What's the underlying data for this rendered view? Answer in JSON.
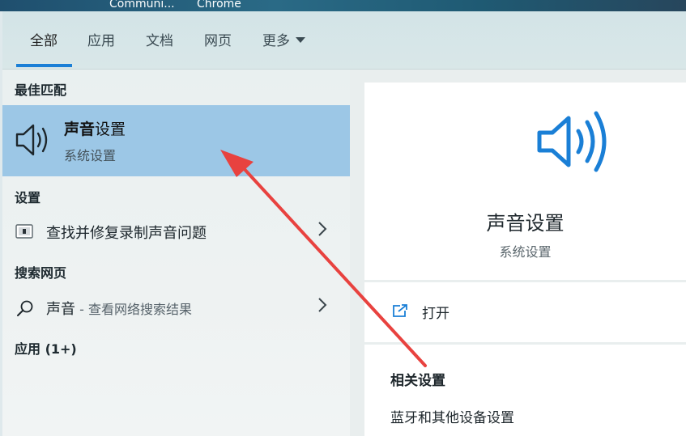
{
  "desktop": {
    "labels": [
      "Communi...",
      "Chrome"
    ]
  },
  "nav": {
    "tabs": [
      {
        "label": "全部",
        "active": true
      },
      {
        "label": "应用"
      },
      {
        "label": "文档"
      },
      {
        "label": "网页"
      },
      {
        "label": "更多"
      }
    ]
  },
  "left": {
    "best_match_heading": "最佳匹配",
    "best_match": {
      "title_bold": "声音",
      "title_rest": "设置",
      "subtitle": "系统设置",
      "icon": "speaker-icon"
    },
    "settings_heading": "设置",
    "settings_item": {
      "label": "查找并修复录制声音问题",
      "icon": "troubleshoot-icon"
    },
    "web_heading": "搜索网页",
    "web_item": {
      "query": "声音",
      "suffix": " - 查看网络搜索结果",
      "icon": "search-icon"
    },
    "apps_heading": "应用 (1+)"
  },
  "right": {
    "title": "声音设置",
    "subtitle": "系统设置",
    "open_label": "打开",
    "related_heading": "相关设置",
    "related_link": "蓝牙和其他设备设置"
  },
  "colors": {
    "accent": "#1a7fd6",
    "selection": "#9cc7e6",
    "annotation_arrow": "#e8423f"
  }
}
